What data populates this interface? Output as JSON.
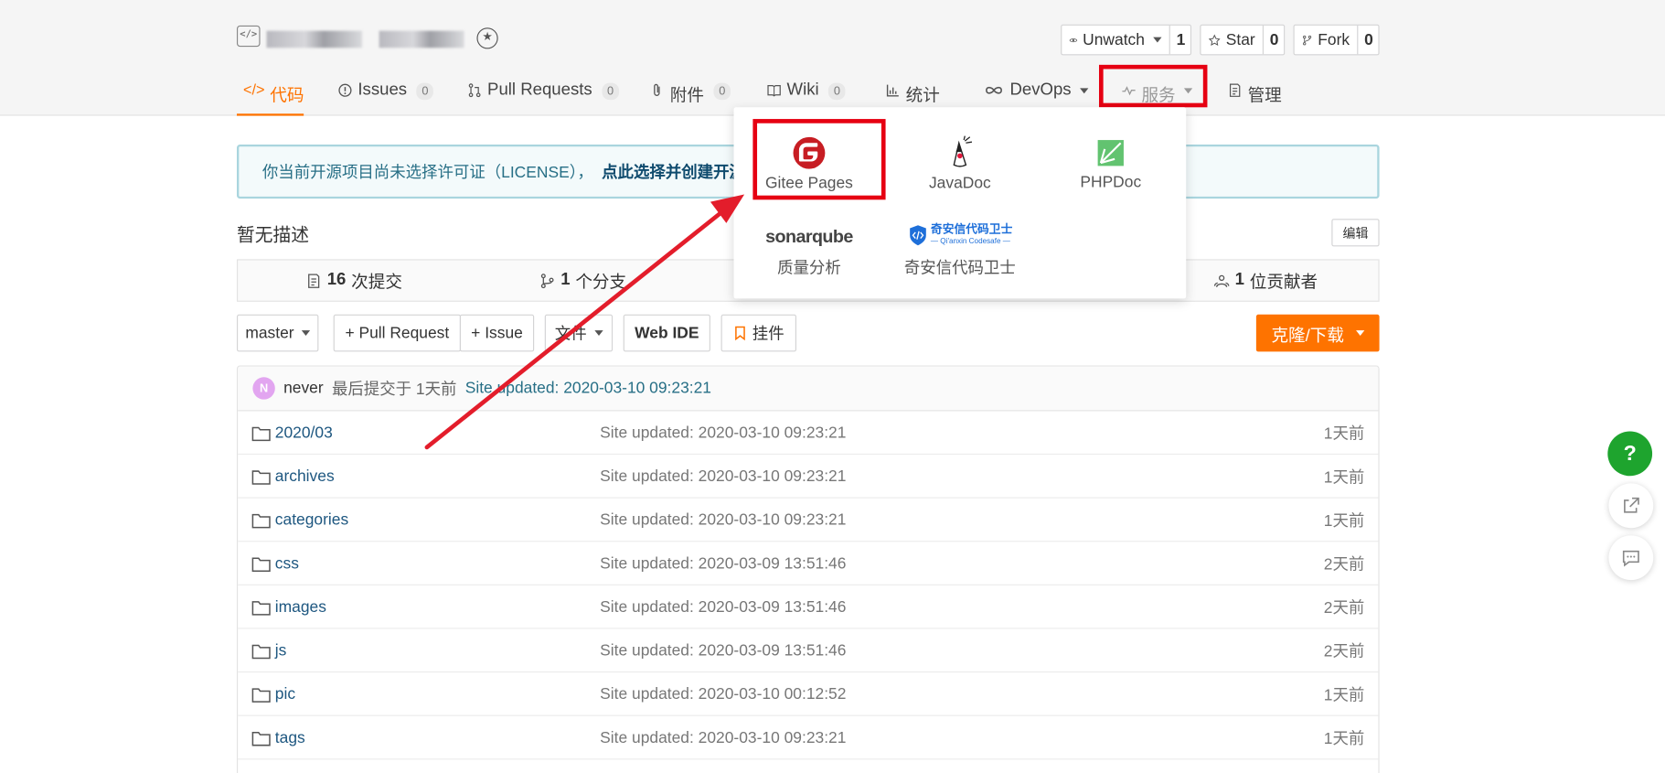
{
  "repo": {
    "icon": "code-icon",
    "badge_icon": "award-icon"
  },
  "actions": {
    "watch": {
      "label": "Unwatch",
      "count": "1"
    },
    "star": {
      "label": "Star",
      "count": "0"
    },
    "fork": {
      "label": "Fork",
      "count": "0"
    }
  },
  "tabs": [
    {
      "label": "代码",
      "count": ""
    },
    {
      "label": "Issues",
      "count": "0"
    },
    {
      "label": "Pull Requests",
      "count": "0"
    },
    {
      "label": "附件",
      "count": "0"
    },
    {
      "label": "Wiki",
      "count": "0"
    },
    {
      "label": "统计",
      "count": ""
    },
    {
      "label": "DevOps",
      "count": ""
    },
    {
      "label": "服务",
      "count": ""
    },
    {
      "label": "管理",
      "count": ""
    }
  ],
  "notice": {
    "text": "你当前开源项目尚未选择许可证（LICENSE），",
    "link": "点此选择并创建开源"
  },
  "description": "暂无描述",
  "edit_label": "编辑",
  "stats": {
    "commits": "16",
    "commits_label": "次提交",
    "branches": "1",
    "branches_label": "个分支",
    "contributors": "1",
    "contributors_label": "位贡献者"
  },
  "toolbar": {
    "branch": "master",
    "pull_request": "+ Pull Request",
    "issue": "+ Issue",
    "file": "文件",
    "web_ide": "Web IDE",
    "widget": "挂件",
    "clone": "克隆/下载"
  },
  "last_commit": {
    "avatar": "N",
    "author": "never",
    "text": "最后提交于 1天前",
    "message": "Site updated: 2020-03-10 09:23:21"
  },
  "files": [
    {
      "name": "2020/03",
      "message": "Site updated: 2020-03-10 09:23:21",
      "time": "1天前"
    },
    {
      "name": "archives",
      "message": "Site updated: 2020-03-10 09:23:21",
      "time": "1天前"
    },
    {
      "name": "categories",
      "message": "Site updated: 2020-03-10 09:23:21",
      "time": "1天前"
    },
    {
      "name": "css",
      "message": "Site updated: 2020-03-09 13:51:46",
      "time": "2天前"
    },
    {
      "name": "images",
      "message": "Site updated: 2020-03-09 13:51:46",
      "time": "2天前"
    },
    {
      "name": "js",
      "message": "Site updated: 2020-03-09 13:51:46",
      "time": "2天前"
    },
    {
      "name": "pic",
      "message": "Site updated: 2020-03-10 00:12:52",
      "time": "1天前"
    },
    {
      "name": "tags",
      "message": "Site updated: 2020-03-10 09:23:21",
      "time": "1天前"
    }
  ],
  "services_menu": [
    {
      "label": "Gitee Pages",
      "icon": "gitee-icon"
    },
    {
      "label": "JavaDoc",
      "icon": "java-duke-icon"
    },
    {
      "label": "PHPDoc",
      "icon": "phpdoc-icon"
    },
    {
      "label": "质量分析",
      "icon": "sonarqube-logo",
      "logo_text": "sonarqube"
    },
    {
      "label": "奇安信代码卫士",
      "icon": "qianxin-codesafe-logo",
      "logo_text": "奇安信代码卫士",
      "logo_subtext": "— Qi'anxin Codesafe —"
    }
  ],
  "floating": {
    "help": "?"
  },
  "colors": {
    "accent": "#fe7300",
    "highlight": "#e60012",
    "help": "#1ea42e",
    "link": "#1e5780"
  }
}
